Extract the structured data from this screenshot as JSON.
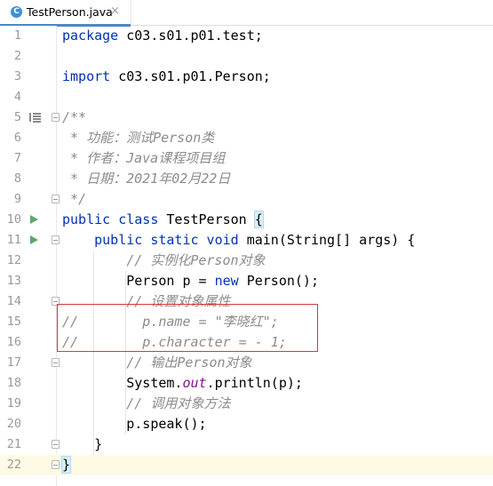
{
  "tab": {
    "title": "TestPerson.java",
    "icon": "class-c-icon",
    "close": "×",
    "icon_letter": "C"
  },
  "editor": {
    "lines": [
      {
        "n": "1"
      },
      {
        "n": "2"
      },
      {
        "n": "3"
      },
      {
        "n": "4"
      },
      {
        "n": "5"
      },
      {
        "n": "6"
      },
      {
        "n": "7"
      },
      {
        "n": "8"
      },
      {
        "n": "9"
      },
      {
        "n": "10"
      },
      {
        "n": "11"
      },
      {
        "n": "12"
      },
      {
        "n": "13"
      },
      {
        "n": "14"
      },
      {
        "n": "15"
      },
      {
        "n": "16"
      },
      {
        "n": "17"
      },
      {
        "n": "18"
      },
      {
        "n": "19"
      },
      {
        "n": "20"
      },
      {
        "n": "21"
      },
      {
        "n": "22"
      }
    ],
    "code": {
      "l1_kw": "package",
      "l1_rest": " c03.s01.p01.test;",
      "l3_kw": "import",
      "l3_rest": " c03.s01.p01.Person;",
      "l5": "/**",
      "l6": " * 功能：测试Person类",
      "l7": " * 作者：Java课程项目组",
      "l8": " * 日期：2021年02月22日",
      "l9": " */",
      "l10_kw": "public class",
      "l10_name": " TestPerson ",
      "l10_brace": "{",
      "l11_indent": "    ",
      "l11_kw": "public static void",
      "l11_rest": " main(String[] args) {",
      "l12_indent": "        ",
      "l12_cmt": "// 实例化Person对象",
      "l13_pre": "        Person p = ",
      "l13_kw": "new",
      "l13_post": " Person();",
      "l14_indent": "        ",
      "l14_cmt": "// 设置对象属性",
      "l15": "//        p.name = \"李晓红\";",
      "l16": "//        p.character = - 1;",
      "l17_indent": "        ",
      "l17_cmt": "// 输出Person对象",
      "l18_pre": "        System.",
      "l18_out": "out",
      "l18_post": ".println(p);",
      "l19_indent": "        ",
      "l19_cmt": "// 调用对象方法",
      "l20": "        p.speak();",
      "l21": "    }",
      "l22": "}"
    }
  }
}
